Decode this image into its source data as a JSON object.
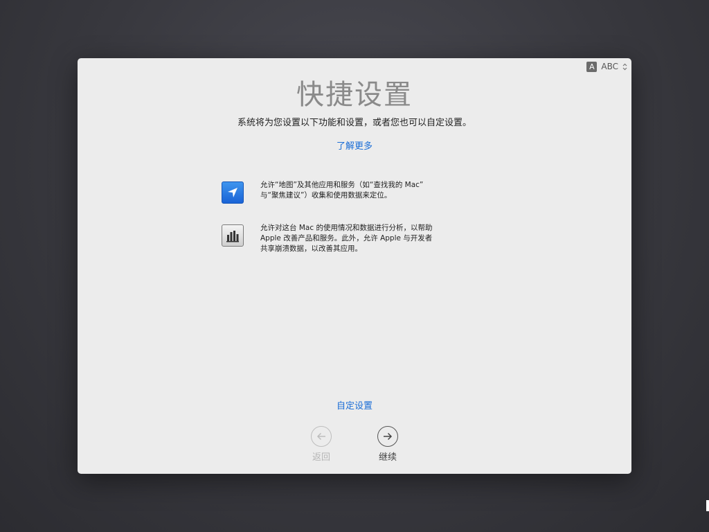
{
  "input_indicator": {
    "badge": "A",
    "label": "ABC"
  },
  "title": "快捷设置",
  "subtitle": "系统将为您设置以下功能和设置，或者您也可以自定设置。",
  "learn_more": "了解更多",
  "features": [
    {
      "icon": "location-arrow-icon",
      "lines": [
        "允许“地图”及其他应用和服务（如“查找我的 Mac”",
        "与“聚焦建议”）收集和使用数据来定位。"
      ]
    },
    {
      "icon": "analytics-chart-icon",
      "lines": [
        "允许对这台 Mac 的使用情况和数据进行分析，以帮助",
        "Apple 改善产品和服务。此外，允许 Apple 与开发者",
        "共享崩溃数据，以改善其应用。"
      ]
    }
  ],
  "customize": "自定设置",
  "back_label": "返回",
  "continue_label": "继续",
  "colors": {
    "link": "#1a6dd6",
    "title": "#8a8a8a"
  }
}
